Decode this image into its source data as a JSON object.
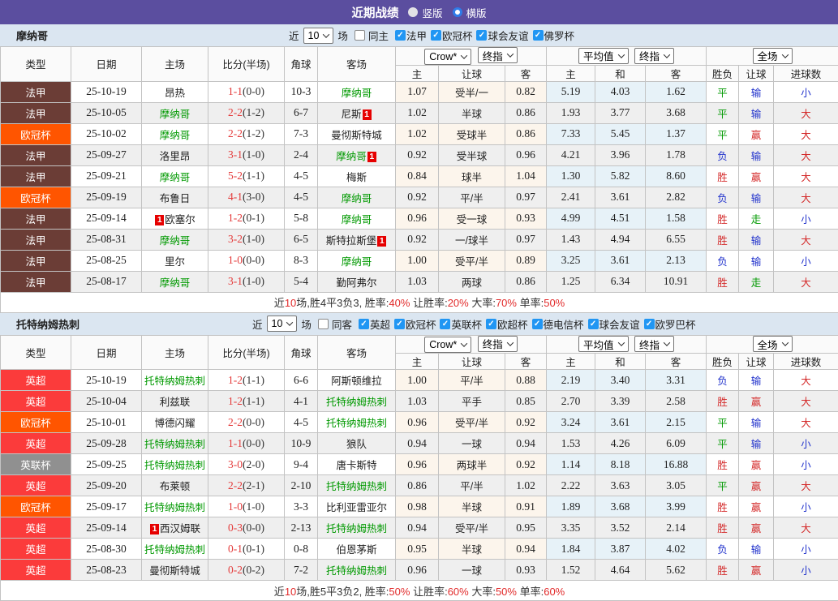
{
  "title_bar": {
    "title": "近期战绩",
    "vertical_label": "竖版",
    "horizontal_label": "横版"
  },
  "labels": {
    "near": "近",
    "matches": "场",
    "col_type": "类型",
    "col_date": "日期",
    "col_home": "主场",
    "col_score": "比分(半场)",
    "col_corner": "角球",
    "col_away": "客场",
    "sub": [
      "主",
      "让球",
      "客",
      "主",
      "和",
      "客",
      "胜负",
      "让球",
      "进球数"
    ],
    "dd_crow": "Crow*",
    "dd_final": "终指",
    "dd_avg": "平均值",
    "dd_full": "全场"
  },
  "red_card_char": "1",
  "league_colors": {
    "法甲": "#6b3d36",
    "欧冠杯": "#ff5500",
    "英超": "#fb3b3b",
    "英联杯": "#909090"
  },
  "result_colors": {
    "胜": "r",
    "赢": "r",
    "大": "r",
    "平": "g",
    "走": "g",
    "负": "b",
    "输": "b",
    "小": "b"
  },
  "sections": [
    {
      "team": "摩纳哥",
      "filter": {
        "count": "10",
        "same_label": "同主",
        "leagues": [
          "法甲",
          "欧冠杯",
          "球会友谊",
          "佛罗杯"
        ]
      },
      "rows": [
        {
          "league": "法甲",
          "date": "25-10-19",
          "home": {
            "n": "昂热",
            "g": false,
            "rc": ""
          },
          "ft": "1-1",
          "ht": "(0-0)",
          "corner": "10-3",
          "away": {
            "n": "摩纳哥",
            "g": true,
            "rc": ""
          },
          "odds": [
            "1.07",
            "受半/一",
            "0.82"
          ],
          "avg": [
            "5.19",
            "4.03",
            "1.62"
          ],
          "results": [
            "平",
            "输",
            "小"
          ]
        },
        {
          "league": "法甲",
          "date": "25-10-05",
          "home": {
            "n": "摩纳哥",
            "g": true,
            "rc": ""
          },
          "ft": "2-2",
          "ht": "(1-2)",
          "corner": "6-7",
          "away": {
            "n": "尼斯",
            "g": false,
            "rc": "post"
          },
          "odds": [
            "1.02",
            "半球",
            "0.86"
          ],
          "avg": [
            "1.93",
            "3.77",
            "3.68"
          ],
          "results": [
            "平",
            "输",
            "大"
          ]
        },
        {
          "league": "欧冠杯",
          "date": "25-10-02",
          "home": {
            "n": "摩纳哥",
            "g": true,
            "rc": ""
          },
          "ft": "2-2",
          "ht": "(1-2)",
          "corner": "7-3",
          "away": {
            "n": "曼彻斯特城",
            "g": false,
            "rc": ""
          },
          "odds": [
            "1.02",
            "受球半",
            "0.86"
          ],
          "avg": [
            "7.33",
            "5.45",
            "1.37"
          ],
          "results": [
            "平",
            "赢",
            "大"
          ]
        },
        {
          "league": "法甲",
          "date": "25-09-27",
          "home": {
            "n": "洛里昂",
            "g": false,
            "rc": ""
          },
          "ft": "3-1",
          "ht": "(1-0)",
          "corner": "2-4",
          "away": {
            "n": "摩纳哥",
            "g": true,
            "rc": "post"
          },
          "odds": [
            "0.92",
            "受半球",
            "0.96"
          ],
          "avg": [
            "4.21",
            "3.96",
            "1.78"
          ],
          "results": [
            "负",
            "输",
            "大"
          ]
        },
        {
          "league": "法甲",
          "date": "25-09-21",
          "home": {
            "n": "摩纳哥",
            "g": true,
            "rc": ""
          },
          "ft": "5-2",
          "ht": "(1-1)",
          "corner": "4-5",
          "away": {
            "n": "梅斯",
            "g": false,
            "rc": ""
          },
          "odds": [
            "0.84",
            "球半",
            "1.04"
          ],
          "avg": [
            "1.30",
            "5.82",
            "8.60"
          ],
          "results": [
            "胜",
            "赢",
            "大"
          ]
        },
        {
          "league": "欧冠杯",
          "date": "25-09-19",
          "home": {
            "n": "布鲁日",
            "g": false,
            "rc": ""
          },
          "ft": "4-1",
          "ht": "(3-0)",
          "corner": "4-5",
          "away": {
            "n": "摩纳哥",
            "g": true,
            "rc": ""
          },
          "odds": [
            "0.92",
            "平/半",
            "0.97"
          ],
          "avg": [
            "2.41",
            "3.61",
            "2.82"
          ],
          "results": [
            "负",
            "输",
            "大"
          ]
        },
        {
          "league": "法甲",
          "date": "25-09-14",
          "home": {
            "n": "欧塞尔",
            "g": false,
            "rc": "pre"
          },
          "ft": "1-2",
          "ht": "(0-1)",
          "corner": "5-8",
          "away": {
            "n": "摩纳哥",
            "g": true,
            "rc": ""
          },
          "odds": [
            "0.96",
            "受一球",
            "0.93"
          ],
          "avg": [
            "4.99",
            "4.51",
            "1.58"
          ],
          "results": [
            "胜",
            "走",
            "小"
          ]
        },
        {
          "league": "法甲",
          "date": "25-08-31",
          "home": {
            "n": "摩纳哥",
            "g": true,
            "rc": ""
          },
          "ft": "3-2",
          "ht": "(1-0)",
          "corner": "6-5",
          "away": {
            "n": "斯特拉斯堡",
            "g": false,
            "rc": "post"
          },
          "odds": [
            "0.92",
            "一/球半",
            "0.97"
          ],
          "avg": [
            "1.43",
            "4.94",
            "6.55"
          ],
          "results": [
            "胜",
            "输",
            "大"
          ]
        },
        {
          "league": "法甲",
          "date": "25-08-25",
          "home": {
            "n": "里尔",
            "g": false,
            "rc": ""
          },
          "ft": "1-0",
          "ht": "(0-0)",
          "corner": "8-3",
          "away": {
            "n": "摩纳哥",
            "g": true,
            "rc": ""
          },
          "odds": [
            "1.00",
            "受平/半",
            "0.89"
          ],
          "avg": [
            "3.25",
            "3.61",
            "2.13"
          ],
          "results": [
            "负",
            "输",
            "小"
          ]
        },
        {
          "league": "法甲",
          "date": "25-08-17",
          "home": {
            "n": "摩纳哥",
            "g": true,
            "rc": ""
          },
          "ft": "3-1",
          "ht": "(1-0)",
          "corner": "5-4",
          "away": {
            "n": "勤阿弗尔",
            "g": false,
            "rc": ""
          },
          "odds": [
            "1.03",
            "两球",
            "0.86"
          ],
          "avg": [
            "1.25",
            "6.34",
            "10.91"
          ],
          "results": [
            "胜",
            "走",
            "大"
          ]
        }
      ],
      "summary": [
        {
          "t": "近",
          "red": false
        },
        {
          "t": "10",
          "red": true
        },
        {
          "t": "场,胜4平3负3, 胜率:",
          "red": false
        },
        {
          "t": "40%",
          "red": true
        },
        {
          "t": " 让胜率:",
          "red": false
        },
        {
          "t": "20%",
          "red": true
        },
        {
          "t": " 大率:",
          "red": false
        },
        {
          "t": "70%",
          "red": true
        },
        {
          "t": " 单率:",
          "red": false
        },
        {
          "t": "50%",
          "red": true
        }
      ]
    },
    {
      "team": "托特纳姆热刺",
      "filter": {
        "count": "10",
        "same_label": "同客",
        "leagues": [
          "英超",
          "欧冠杯",
          "英联杯",
          "欧超杯",
          "德电信杯",
          "球会友谊",
          "欧罗巴杯"
        ]
      },
      "rows": [
        {
          "league": "英超",
          "date": "25-10-19",
          "home": {
            "n": "托特纳姆热刺",
            "g": true,
            "rc": ""
          },
          "ft": "1-2",
          "ht": "(1-1)",
          "corner": "6-6",
          "away": {
            "n": "阿斯顿维拉",
            "g": false,
            "rc": ""
          },
          "odds": [
            "1.00",
            "平/半",
            "0.88"
          ],
          "avg": [
            "2.19",
            "3.40",
            "3.31"
          ],
          "results": [
            "负",
            "输",
            "大"
          ]
        },
        {
          "league": "英超",
          "date": "25-10-04",
          "home": {
            "n": "利兹联",
            "g": false,
            "rc": ""
          },
          "ft": "1-2",
          "ht": "(1-1)",
          "corner": "4-1",
          "away": {
            "n": "托特纳姆热刺",
            "g": true,
            "rc": ""
          },
          "odds": [
            "1.03",
            "平手",
            "0.85"
          ],
          "avg": [
            "2.70",
            "3.39",
            "2.58"
          ],
          "results": [
            "胜",
            "赢",
            "大"
          ]
        },
        {
          "league": "欧冠杯",
          "date": "25-10-01",
          "home": {
            "n": "博德闪耀",
            "g": false,
            "rc": ""
          },
          "ft": "2-2",
          "ht": "(0-0)",
          "corner": "4-5",
          "away": {
            "n": "托特纳姆热刺",
            "g": true,
            "rc": ""
          },
          "odds": [
            "0.96",
            "受平/半",
            "0.92"
          ],
          "avg": [
            "3.24",
            "3.61",
            "2.15"
          ],
          "results": [
            "平",
            "输",
            "大"
          ]
        },
        {
          "league": "英超",
          "date": "25-09-28",
          "home": {
            "n": "托特纳姆热刺",
            "g": true,
            "rc": ""
          },
          "ft": "1-1",
          "ht": "(0-0)",
          "corner": "10-9",
          "away": {
            "n": "狼队",
            "g": false,
            "rc": ""
          },
          "odds": [
            "0.94",
            "一球",
            "0.94"
          ],
          "avg": [
            "1.53",
            "4.26",
            "6.09"
          ],
          "results": [
            "平",
            "输",
            "小"
          ]
        },
        {
          "league": "英联杯",
          "date": "25-09-25",
          "home": {
            "n": "托特纳姆热刺",
            "g": true,
            "rc": ""
          },
          "ft": "3-0",
          "ht": "(2-0)",
          "corner": "9-4",
          "away": {
            "n": "唐卡斯特",
            "g": false,
            "rc": ""
          },
          "odds": [
            "0.96",
            "两球半",
            "0.92"
          ],
          "avg": [
            "1.14",
            "8.18",
            "16.88"
          ],
          "results": [
            "胜",
            "赢",
            "小"
          ]
        },
        {
          "league": "英超",
          "date": "25-09-20",
          "home": {
            "n": "布莱顿",
            "g": false,
            "rc": ""
          },
          "ft": "2-2",
          "ht": "(2-1)",
          "corner": "2-10",
          "away": {
            "n": "托特纳姆热刺",
            "g": true,
            "rc": ""
          },
          "odds": [
            "0.86",
            "平/半",
            "1.02"
          ],
          "avg": [
            "2.22",
            "3.63",
            "3.05"
          ],
          "results": [
            "平",
            "赢",
            "大"
          ]
        },
        {
          "league": "欧冠杯",
          "date": "25-09-17",
          "home": {
            "n": "托特纳姆热刺",
            "g": true,
            "rc": ""
          },
          "ft": "1-0",
          "ht": "(1-0)",
          "corner": "3-3",
          "away": {
            "n": "比利亚雷亚尔",
            "g": false,
            "rc": ""
          },
          "odds": [
            "0.98",
            "半球",
            "0.91"
          ],
          "avg": [
            "1.89",
            "3.68",
            "3.99"
          ],
          "results": [
            "胜",
            "赢",
            "小"
          ]
        },
        {
          "league": "英超",
          "date": "25-09-14",
          "home": {
            "n": "西汉姆联",
            "g": false,
            "rc": "pre"
          },
          "ft": "0-3",
          "ht": "(0-0)",
          "corner": "2-13",
          "away": {
            "n": "托特纳姆热刺",
            "g": true,
            "rc": ""
          },
          "odds": [
            "0.94",
            "受平/半",
            "0.95"
          ],
          "avg": [
            "3.35",
            "3.52",
            "2.14"
          ],
          "results": [
            "胜",
            "赢",
            "大"
          ]
        },
        {
          "league": "英超",
          "date": "25-08-30",
          "home": {
            "n": "托特纳姆热刺",
            "g": true,
            "rc": ""
          },
          "ft": "0-1",
          "ht": "(0-1)",
          "corner": "0-8",
          "away": {
            "n": "伯恩茅斯",
            "g": false,
            "rc": ""
          },
          "odds": [
            "0.95",
            "半球",
            "0.94"
          ],
          "avg": [
            "1.84",
            "3.87",
            "4.02"
          ],
          "results": [
            "负",
            "输",
            "小"
          ]
        },
        {
          "league": "英超",
          "date": "25-08-23",
          "home": {
            "n": "曼彻斯特城",
            "g": false,
            "rc": ""
          },
          "ft": "0-2",
          "ht": "(0-2)",
          "corner": "7-2",
          "away": {
            "n": "托特纳姆热刺",
            "g": true,
            "rc": ""
          },
          "odds": [
            "0.96",
            "一球",
            "0.93"
          ],
          "avg": [
            "1.52",
            "4.64",
            "5.62"
          ],
          "results": [
            "胜",
            "赢",
            "小"
          ]
        }
      ],
      "summary": [
        {
          "t": "近",
          "red": false
        },
        {
          "t": "10",
          "red": true
        },
        {
          "t": "场,胜5平3负2, 胜率:",
          "red": false
        },
        {
          "t": "50%",
          "red": true
        },
        {
          "t": " 让胜率:",
          "red": false
        },
        {
          "t": "60%",
          "red": true
        },
        {
          "t": " 大率:",
          "red": false
        },
        {
          "t": "50%",
          "red": true
        },
        {
          "t": " 单率:",
          "red": false
        },
        {
          "t": "60%",
          "red": true
        }
      ]
    }
  ]
}
